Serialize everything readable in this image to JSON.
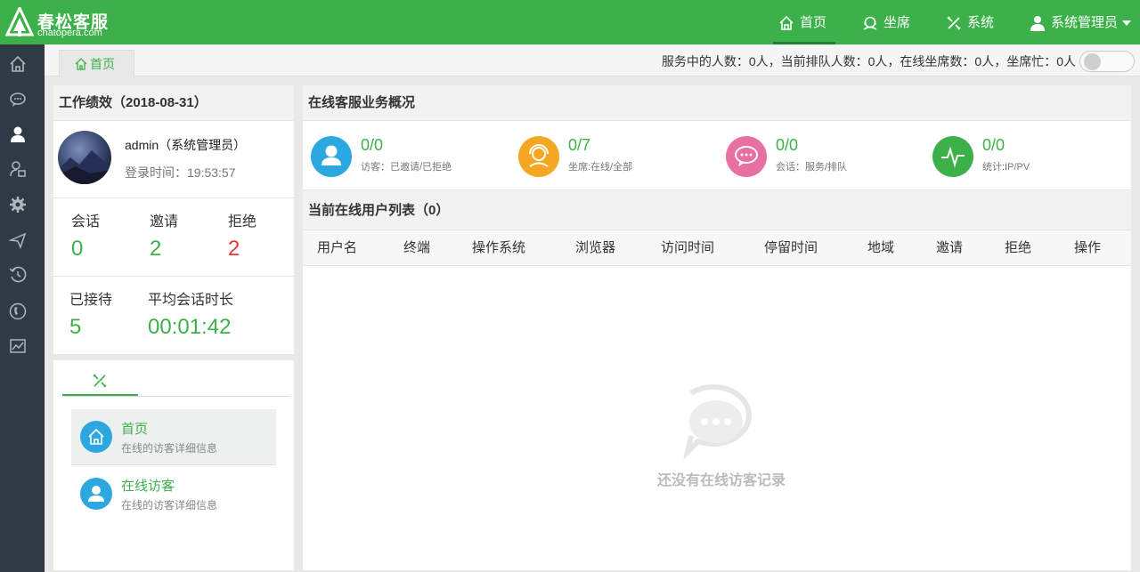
{
  "brand": {
    "name": "春松客服",
    "subtitle": "chatopera.com"
  },
  "nav": {
    "items": [
      {
        "label": "首页",
        "icon": "home-icon",
        "active": true
      },
      {
        "label": "坐席",
        "icon": "headset-icon",
        "active": false
      },
      {
        "label": "系统",
        "icon": "tools-icon",
        "active": false
      }
    ],
    "user": {
      "label": "系统管理员",
      "icon": "user-icon"
    }
  },
  "sidebar": {
    "icons": [
      "home-icon",
      "chat-icon",
      "user-icon",
      "contacts-icon",
      "gear-icon",
      "send-icon",
      "history-icon",
      "phone-icon",
      "report-icon"
    ]
  },
  "tabs": {
    "home_label": "首页"
  },
  "status": {
    "text": "服务中的人数：0人，当前排队人数：0人，在线坐席数：0人，坐席忙：0人",
    "busy_toggle_on": false
  },
  "performance": {
    "title": "工作绩效（2018-08-31）",
    "username": "admin（系统管理员）",
    "login_time": "登录时间：19:53:57",
    "stats": {
      "session_label": "会话",
      "session_value": "0",
      "invite_label": "邀请",
      "invite_value": "2",
      "reject_label": "拒绝",
      "reject_value": "2",
      "received_label": "已接待",
      "received_value": "5",
      "avg_label": "平均会话时长",
      "avg_value": "00:01:42"
    }
  },
  "menu": {
    "items": [
      {
        "title": "首页",
        "desc": "在线的访客详细信息",
        "icon": "home-icon",
        "active": true
      },
      {
        "title": "在线访客",
        "desc": "在线的访客详细信息",
        "icon": "user-icon",
        "active": false
      }
    ]
  },
  "overview": {
    "title": "在线客服业务概况",
    "kpis": [
      {
        "value": "0/0",
        "label": "访客：已邀请/已拒绝",
        "color": "#2ca7e0",
        "icon": "visitor-icon"
      },
      {
        "value": "0/7",
        "label": "坐席:在线/全部",
        "color": "#f5a623",
        "icon": "agent-icon"
      },
      {
        "value": "0/0",
        "label": "会话：服务/排队",
        "color": "#e86fa1",
        "icon": "chat-bubble-icon"
      },
      {
        "value": "0/0",
        "label": "统计:IP/PV",
        "color": "#3cb14a",
        "icon": "pulse-icon"
      }
    ]
  },
  "online_list": {
    "title": "当前在线用户列表（0）",
    "columns": [
      "用户名",
      "终端",
      "操作系统",
      "浏览器",
      "访问时间",
      "停留时间",
      "地域",
      "邀请",
      "拒绝",
      "操作"
    ],
    "empty_text": "还没有在线访客记录"
  },
  "colors": {
    "brand": "#3cb14a",
    "sidebar": "#2f3a44",
    "danger": "#e53935"
  }
}
